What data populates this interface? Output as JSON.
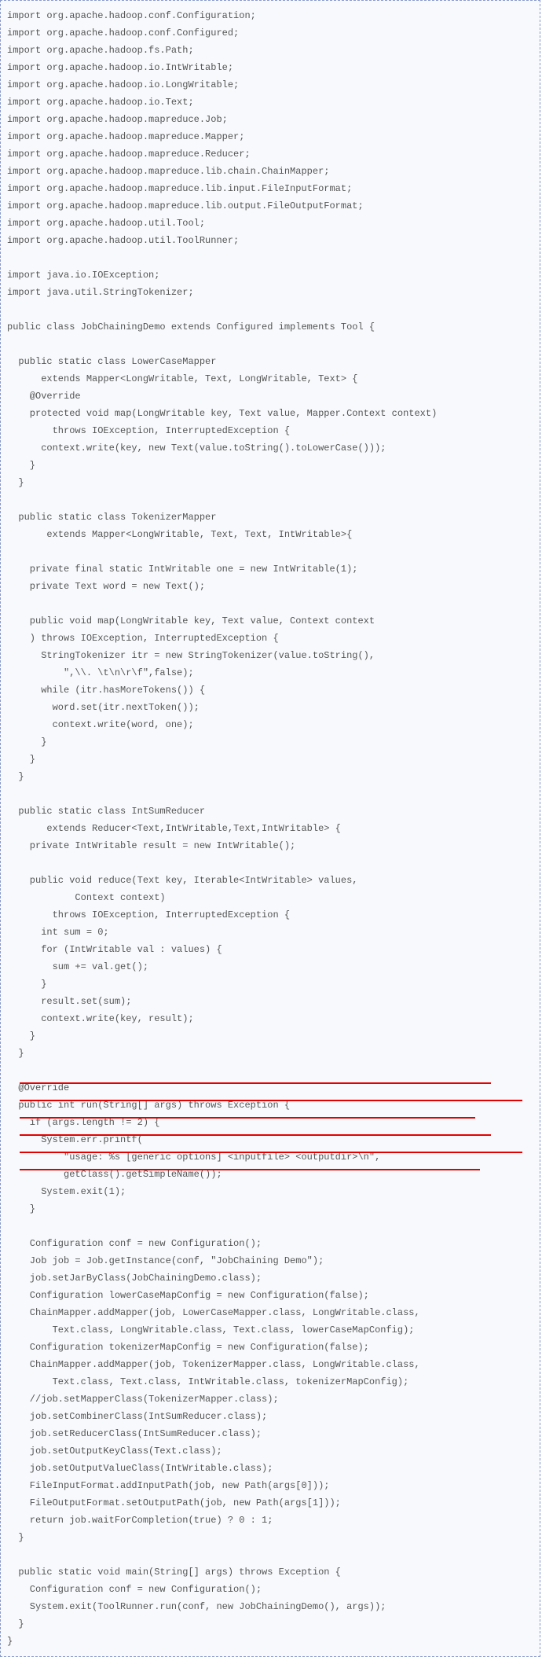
{
  "code_lines": [
    "import org.apache.hadoop.conf.Configuration;",
    "import org.apache.hadoop.conf.Configured;",
    "import org.apache.hadoop.fs.Path;",
    "import org.apache.hadoop.io.IntWritable;",
    "import org.apache.hadoop.io.LongWritable;",
    "import org.apache.hadoop.io.Text;",
    "import org.apache.hadoop.mapreduce.Job;",
    "import org.apache.hadoop.mapreduce.Mapper;",
    "import org.apache.hadoop.mapreduce.Reducer;",
    "import org.apache.hadoop.mapreduce.lib.chain.ChainMapper;",
    "import org.apache.hadoop.mapreduce.lib.input.FileInputFormat;",
    "import org.apache.hadoop.mapreduce.lib.output.FileOutputFormat;",
    "import org.apache.hadoop.util.Tool;",
    "import org.apache.hadoop.util.ToolRunner;",
    "",
    "import java.io.IOException;",
    "import java.util.StringTokenizer;",
    "",
    "public class JobChainingDemo extends Configured implements Tool {",
    "",
    "  public static class LowerCaseMapper",
    "      extends Mapper<LongWritable, Text, LongWritable, Text> {",
    "    @Override",
    "    protected void map(LongWritable key, Text value, Mapper.Context context)",
    "        throws IOException, InterruptedException {",
    "      context.write(key, new Text(value.toString().toLowerCase()));",
    "    }",
    "  }",
    "",
    "  public static class TokenizerMapper",
    "       extends Mapper<LongWritable, Text, Text, IntWritable>{",
    "",
    "    private final static IntWritable one = new IntWritable(1);",
    "    private Text word = new Text();",
    "",
    "    public void map(LongWritable key, Text value, Context context",
    "    ) throws IOException, InterruptedException {",
    "      StringTokenizer itr = new StringTokenizer(value.toString(),",
    "          \",\\\\. \\t\\n\\r\\f\",false);",
    "      while (itr.hasMoreTokens()) {",
    "        word.set(itr.nextToken());",
    "        context.write(word, one);",
    "      }",
    "    }",
    "  }",
    "",
    "  public static class IntSumReducer",
    "       extends Reducer<Text,IntWritable,Text,IntWritable> {",
    "    private IntWritable result = new IntWritable();",
    "",
    "    public void reduce(Text key, Iterable<IntWritable> values,",
    "            Context context)",
    "        throws IOException, InterruptedException {",
    "      int sum = 0;",
    "      for (IntWritable val : values) {",
    "        sum += val.get();",
    "      }",
    "      result.set(sum);",
    "      context.write(key, result);",
    "    }",
    "  }",
    "",
    "  @Override",
    "  public int run(String[] args) throws Exception {",
    "    if (args.length != 2) {",
    "      System.err.printf(",
    "          \"usage: %s [generic options] <inputfile> <outputdir>\\n\",",
    "          getClass().getSimpleName());",
    "      System.exit(1);",
    "    }",
    "",
    "    Configuration conf = new Configuration();",
    "    Job job = Job.getInstance(conf, \"JobChaining Demo\");",
    "    job.setJarByClass(JobChainingDemo.class);",
    "    Configuration lowerCaseMapConfig = new Configuration(false);",
    "    ChainMapper.addMapper(job, LowerCaseMapper.class, LongWritable.class,",
    "        Text.class, LongWritable.class, Text.class, lowerCaseMapConfig);",
    "    Configuration tokenizerMapConfig = new Configuration(false);",
    "    ChainMapper.addMapper(job, TokenizerMapper.class, LongWritable.class,",
    "        Text.class, Text.class, IntWritable.class, tokenizerMapConfig);",
    "    //job.setMapperClass(TokenizerMapper.class);",
    "    job.setCombinerClass(IntSumReducer.class);",
    "    job.setReducerClass(IntSumReducer.class);",
    "    job.setOutputKeyClass(Text.class);",
    "    job.setOutputValueClass(IntWritable.class);",
    "    FileInputFormat.addInputPath(job, new Path(args[0]));",
    "    FileOutputFormat.setOutputPath(job, new Path(args[1]));",
    "    return job.waitForCompletion(true) ? 0 : 1;",
    "  }",
    "",
    "  public static void main(String[] args) throws Exception {",
    "    Configuration conf = new Configuration();",
    "    System.exit(ToolRunner.run(conf, new JobChainingDemo(), args));",
    "  }",
    "}"
  ],
  "highlighted_line_indices": [
    74,
    75,
    76,
    77,
    78,
    79
  ]
}
